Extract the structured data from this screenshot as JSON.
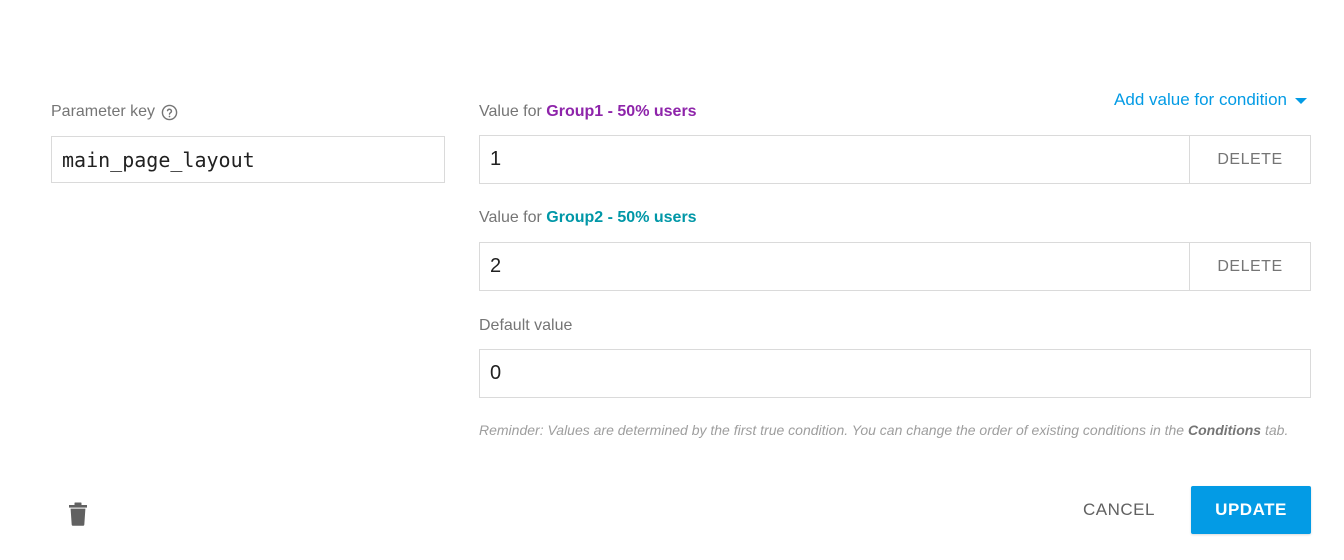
{
  "param": {
    "label": "Parameter key",
    "help_icon": "help-circle-icon",
    "key_value": "main_page_layout"
  },
  "add_condition": {
    "label": "Add value for condition",
    "icon": "caret-down-icon"
  },
  "values": [
    {
      "prefix": "Value for ",
      "condition": "Group1 - 50% users",
      "condition_color": "#8e24aa",
      "value": "1",
      "delete_label": "DELETE"
    },
    {
      "prefix": "Value for ",
      "condition": "Group2 - 50% users",
      "condition_color": "#0097a7",
      "value": "2",
      "delete_label": "DELETE"
    }
  ],
  "default_value": {
    "label": "Default value",
    "value": "0"
  },
  "reminder": {
    "text_before": "Reminder: Values are determined by the first true condition. You can change the order of existing conditions in the ",
    "emphasis": "Conditions",
    "text_after": " tab."
  },
  "footer": {
    "trash_icon": "trash-icon",
    "cancel_label": "CANCEL",
    "update_label": "UPDATE"
  },
  "colors": {
    "accent": "#039be5",
    "group1": "#8e24aa",
    "group2": "#0097a7"
  }
}
